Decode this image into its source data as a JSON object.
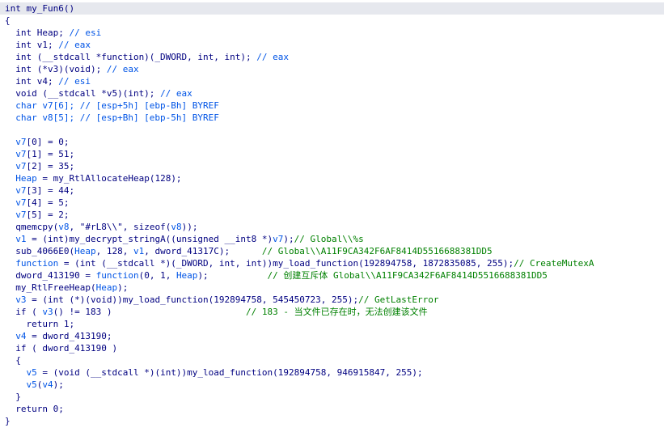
{
  "colors": {
    "plain": "#000080",
    "comment": "#008000",
    "var": "#0054e6",
    "current_line_bg": "#e6e8ee"
  },
  "lines": [
    {
      "current": true,
      "tokens": [
        {
          "t": "int my_Fun6()",
          "c": "plain"
        }
      ]
    },
    {
      "tokens": [
        {
          "t": "{",
          "c": "plain"
        }
      ]
    },
    {
      "tokens": [
        {
          "t": "  int Heap; ",
          "c": "plain"
        },
        {
          "t": "// esi",
          "c": "var"
        }
      ]
    },
    {
      "tokens": [
        {
          "t": "  int v1; ",
          "c": "plain"
        },
        {
          "t": "// eax",
          "c": "var"
        }
      ]
    },
    {
      "tokens": [
        {
          "t": "  int (__stdcall *function)(_DWORD, int, int); ",
          "c": "plain"
        },
        {
          "t": "// eax",
          "c": "var"
        }
      ]
    },
    {
      "tokens": [
        {
          "t": "  int (*v3)(void); ",
          "c": "plain"
        },
        {
          "t": "// eax",
          "c": "var"
        }
      ]
    },
    {
      "tokens": [
        {
          "t": "  int v4; ",
          "c": "plain"
        },
        {
          "t": "// esi",
          "c": "var"
        }
      ]
    },
    {
      "tokens": [
        {
          "t": "  void (__stdcall *v5)(int); ",
          "c": "plain"
        },
        {
          "t": "// eax",
          "c": "var"
        }
      ]
    },
    {
      "tokens": [
        {
          "t": "  char v7[6]; // [esp+5h] [ebp-Bh] BYREF",
          "c": "var"
        }
      ]
    },
    {
      "tokens": [
        {
          "t": "  char v8[5]; // [esp+Bh] [ebp-5h] BYREF",
          "c": "var"
        }
      ]
    },
    {
      "tokens": [
        {
          "t": "",
          "c": "plain"
        }
      ]
    },
    {
      "tokens": [
        {
          "t": "  v7",
          "c": "var"
        },
        {
          "t": "[0] = 0;",
          "c": "plain"
        }
      ]
    },
    {
      "tokens": [
        {
          "t": "  v7",
          "c": "var"
        },
        {
          "t": "[1] = 51;",
          "c": "plain"
        }
      ]
    },
    {
      "tokens": [
        {
          "t": "  v7",
          "c": "var"
        },
        {
          "t": "[2] = 35;",
          "c": "plain"
        }
      ]
    },
    {
      "tokens": [
        {
          "t": "  Heap",
          "c": "var"
        },
        {
          "t": " = my_RtlAllocateHeap(128);",
          "c": "plain"
        }
      ]
    },
    {
      "tokens": [
        {
          "t": "  v7",
          "c": "var"
        },
        {
          "t": "[3] = 44;",
          "c": "plain"
        }
      ]
    },
    {
      "tokens": [
        {
          "t": "  v7",
          "c": "var"
        },
        {
          "t": "[4] = 5;",
          "c": "plain"
        }
      ]
    },
    {
      "tokens": [
        {
          "t": "  v7",
          "c": "var"
        },
        {
          "t": "[5] = 2;",
          "c": "plain"
        }
      ]
    },
    {
      "tokens": [
        {
          "t": "  qmemcpy(",
          "c": "plain"
        },
        {
          "t": "v8",
          "c": "var"
        },
        {
          "t": ", \"#rL8\\\\\", sizeof(",
          "c": "plain"
        },
        {
          "t": "v8",
          "c": "var"
        },
        {
          "t": "));",
          "c": "plain"
        }
      ]
    },
    {
      "tokens": [
        {
          "t": "  v1",
          "c": "var"
        },
        {
          "t": " = (int)my_decrypt_stringA((unsigned __int8 *)",
          "c": "plain"
        },
        {
          "t": "v7",
          "c": "var"
        },
        {
          "t": ");",
          "c": "plain"
        },
        {
          "t": "// Global\\\\%s",
          "c": "comment"
        }
      ]
    },
    {
      "tokens": [
        {
          "t": "  sub_4066E0(",
          "c": "plain"
        },
        {
          "t": "Heap",
          "c": "var"
        },
        {
          "t": ", 128, ",
          "c": "plain"
        },
        {
          "t": "v1",
          "c": "var"
        },
        {
          "t": ", dword_41317C);      ",
          "c": "plain"
        },
        {
          "t": "// Global\\\\A11F9CA342F6AF8414D5516688381DD5",
          "c": "comment"
        }
      ]
    },
    {
      "tokens": [
        {
          "t": "  function",
          "c": "var"
        },
        {
          "t": " = (int (__stdcall *)(_DWORD, int, int))my_load_function(192894758, 1872835085, 255);",
          "c": "plain"
        },
        {
          "t": "// CreateMutexA",
          "c": "comment"
        }
      ]
    },
    {
      "tokens": [
        {
          "t": "  dword_413190 = ",
          "c": "plain"
        },
        {
          "t": "function",
          "c": "var"
        },
        {
          "t": "(0, 1, ",
          "c": "plain"
        },
        {
          "t": "Heap",
          "c": "var"
        },
        {
          "t": ");           ",
          "c": "plain"
        },
        {
          "t": "// 创建互斥体 Global\\\\A11F9CA342F6AF8414D5516688381DD5",
          "c": "comment"
        }
      ]
    },
    {
      "tokens": [
        {
          "t": "  my_RtlFreeHeap(",
          "c": "plain"
        },
        {
          "t": "Heap",
          "c": "var"
        },
        {
          "t": ");",
          "c": "plain"
        }
      ]
    },
    {
      "tokens": [
        {
          "t": "  v3",
          "c": "var"
        },
        {
          "t": " = (int (*)(void))my_load_function(192894758, 545450723, 255);",
          "c": "plain"
        },
        {
          "t": "// GetLastError",
          "c": "comment"
        }
      ]
    },
    {
      "tokens": [
        {
          "t": "  if ( ",
          "c": "plain"
        },
        {
          "t": "v3",
          "c": "var"
        },
        {
          "t": "() != 183 )                         ",
          "c": "plain"
        },
        {
          "t": "// 183 - 当文件已存在时，无法创建该文件",
          "c": "comment"
        }
      ]
    },
    {
      "tokens": [
        {
          "t": "    return 1;",
          "c": "plain"
        }
      ]
    },
    {
      "tokens": [
        {
          "t": "  v4",
          "c": "var"
        },
        {
          "t": " = dword_413190;",
          "c": "plain"
        }
      ]
    },
    {
      "tokens": [
        {
          "t": "  if ( dword_413190 )",
          "c": "plain"
        }
      ]
    },
    {
      "tokens": [
        {
          "t": "  {",
          "c": "plain"
        }
      ]
    },
    {
      "tokens": [
        {
          "t": "    v5",
          "c": "var"
        },
        {
          "t": " = (void (__stdcall *)(int))my_load_function(192894758, 946915847, 255);",
          "c": "plain"
        }
      ]
    },
    {
      "tokens": [
        {
          "t": "    v5",
          "c": "var"
        },
        {
          "t": "(",
          "c": "plain"
        },
        {
          "t": "v4",
          "c": "var"
        },
        {
          "t": ");",
          "c": "plain"
        }
      ]
    },
    {
      "tokens": [
        {
          "t": "  }",
          "c": "plain"
        }
      ]
    },
    {
      "tokens": [
        {
          "t": "  return 0;",
          "c": "plain"
        }
      ]
    },
    {
      "tokens": [
        {
          "t": "}",
          "c": "plain"
        }
      ]
    }
  ]
}
